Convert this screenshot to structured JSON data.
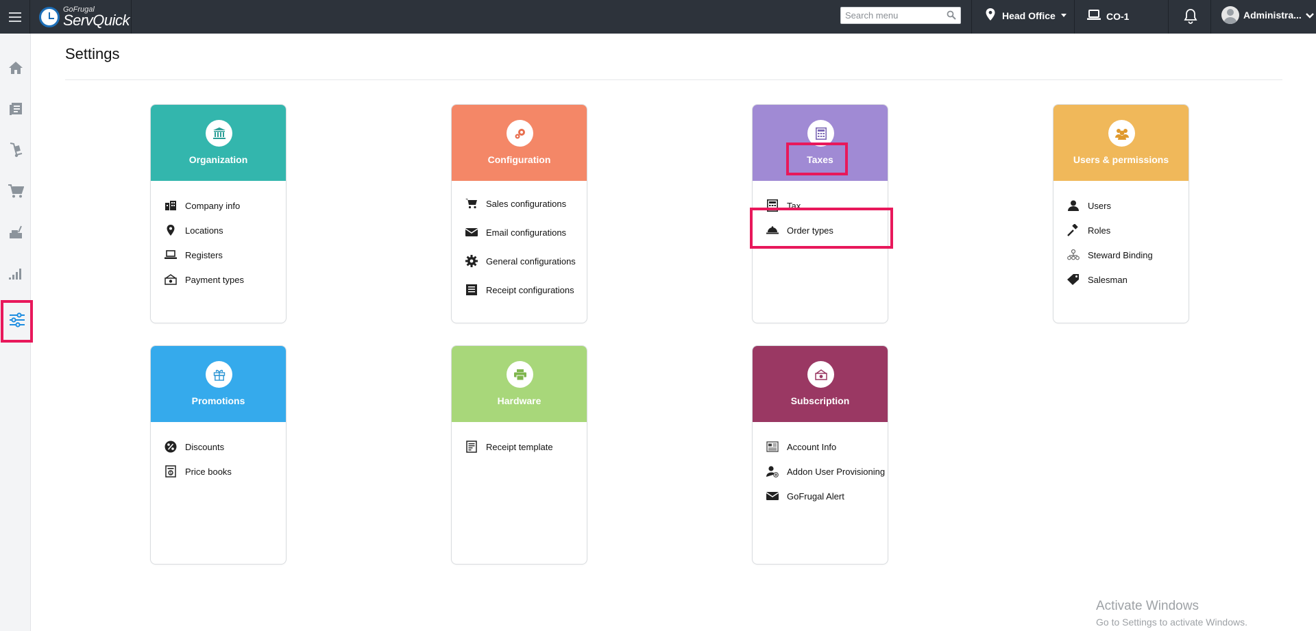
{
  "app": {
    "brand_small": "GoFrugal",
    "brand_name": "ServQuick"
  },
  "topbar": {
    "search_placeholder": "Search menu",
    "location": "Head Office",
    "register": "CO-1",
    "user": "Administra..."
  },
  "sidebar": {
    "items": [
      {
        "name": "home-icon"
      },
      {
        "name": "catalog-icon"
      },
      {
        "name": "inventory-icon"
      },
      {
        "name": "cart-icon"
      },
      {
        "name": "pos-icon"
      },
      {
        "name": "reports-icon"
      },
      {
        "name": "settings-sliders-icon",
        "active": true
      }
    ]
  },
  "page": {
    "title": "Settings"
  },
  "cards": {
    "organization": {
      "title": "Organization",
      "color": "#33b6ad",
      "items": [
        "Company info",
        "Locations",
        "Registers",
        "Payment types"
      ]
    },
    "configuration": {
      "title": "Configuration",
      "color": "#f48767",
      "items": [
        "Sales configurations",
        "Email configurations",
        "General configurations",
        "Receipt configurations"
      ]
    },
    "taxes": {
      "title": "Taxes",
      "color": "#a08ad4",
      "items": [
        "Tax",
        "Order types"
      ]
    },
    "users": {
      "title": "Users & permissions",
      "color": "#f0b85a",
      "items": [
        "Users",
        "Roles",
        "Steward Binding",
        "Salesman"
      ]
    },
    "promotions": {
      "title": "Promotions",
      "color": "#35aaec",
      "items": [
        "Discounts",
        "Price books"
      ]
    },
    "hardware": {
      "title": "Hardware",
      "color": "#a8d77a",
      "items": [
        "Receipt template"
      ]
    },
    "subscription": {
      "title": "Subscription",
      "color": "#9a3863",
      "items": [
        "Account Info",
        "Addon User Provisioning",
        "GoFrugal Alert"
      ]
    }
  },
  "highlight_color": "#e8185b",
  "watermark": {
    "line1": "Activate Windows",
    "line2": "Go to Settings to activate Windows."
  }
}
